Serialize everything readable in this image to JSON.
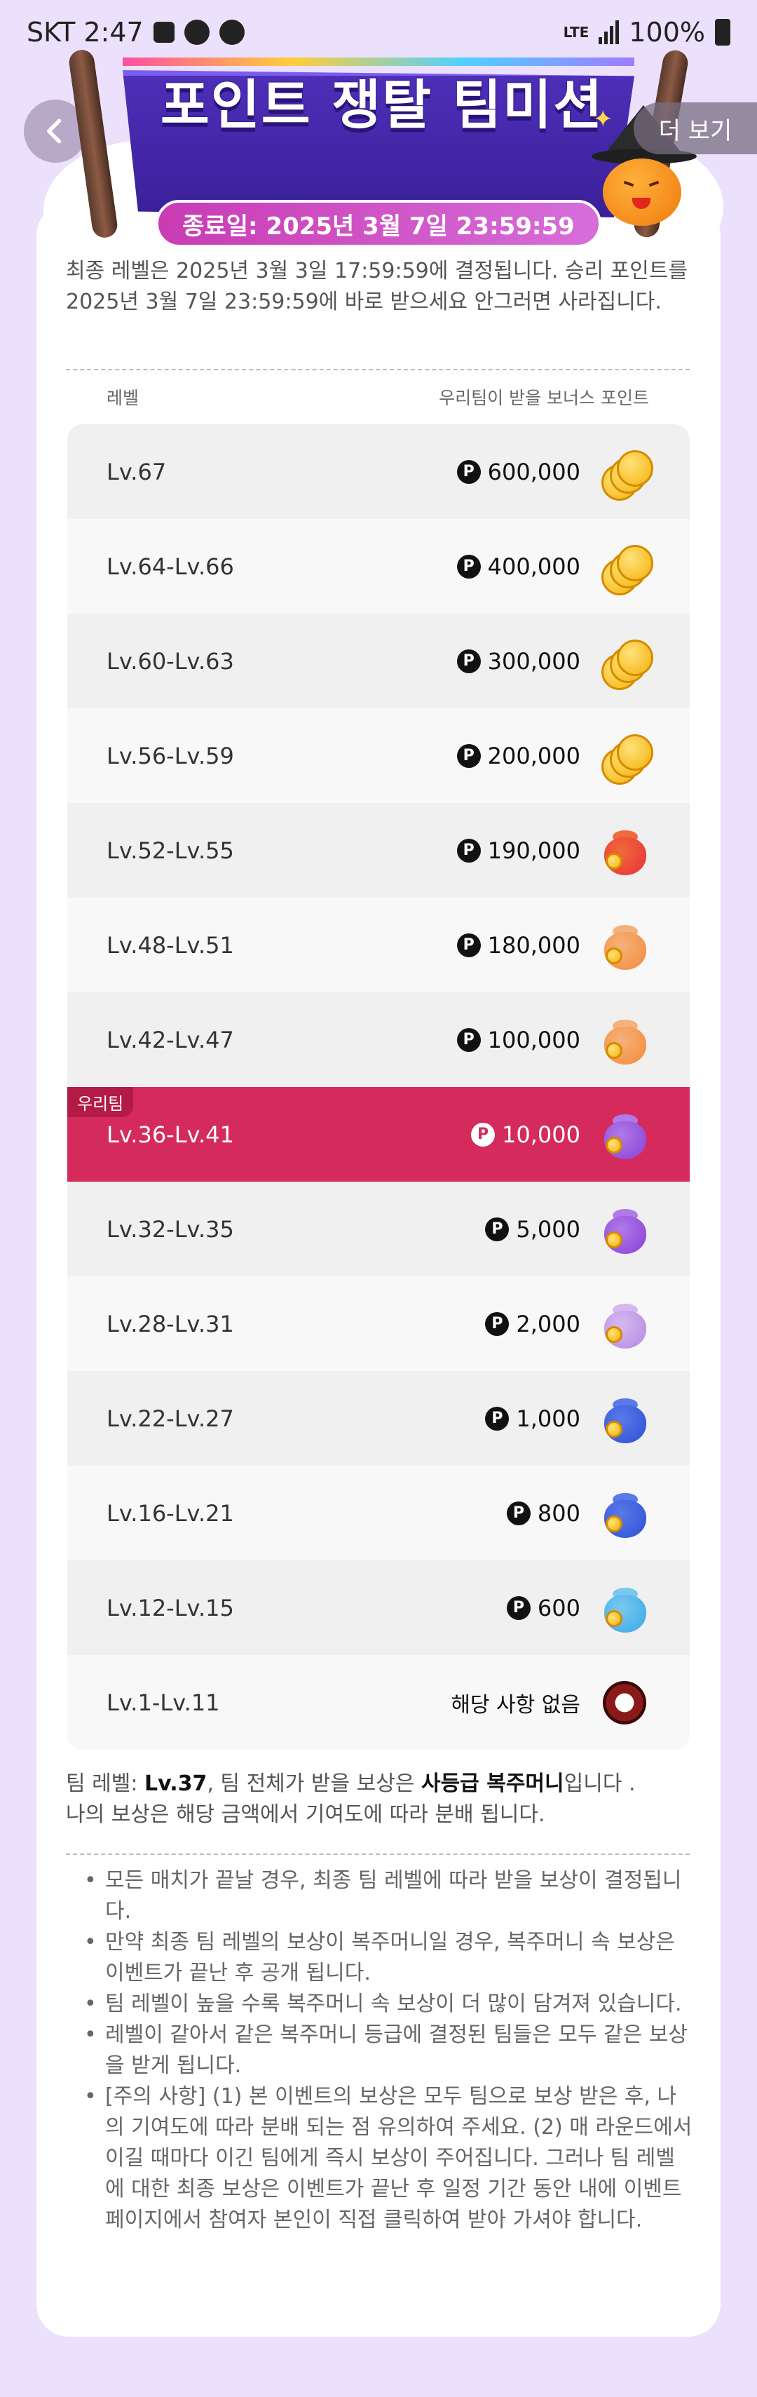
{
  "status_bar": {
    "carrier_time": "SKT 2:47",
    "battery": "100%",
    "network": "LTE"
  },
  "header": {
    "back_icon": "chevron-left-icon",
    "more_label": "더 보기"
  },
  "banner": {
    "title": "포인트 쟁탈 팀미션",
    "end_date": "종료일: 2025년 3월 7일 23:59:59"
  },
  "intro": "최종 레벨은 2025년 3월 3일 17:59:59에 결정됩니다. 승리 포인트를 2025년 3월 7일 23:59:59에 바로 받으세요 안그러면 사라집니다.",
  "table": {
    "col_level": "레벨",
    "col_bonus": "우리팀이 받을 보너스 포인트",
    "my_team_tag": "우리팀",
    "rows": [
      {
        "level": "Lv.67",
        "points": "600,000",
        "icon": "coin-stack-icon"
      },
      {
        "level": "Lv.64-Lv.66",
        "points": "400,000",
        "icon": "coin-stack-icon"
      },
      {
        "level": "Lv.60-Lv.63",
        "points": "300,000",
        "icon": "coin-stack-icon"
      },
      {
        "level": "Lv.56-Lv.59",
        "points": "200,000",
        "icon": "coin-stack-icon"
      },
      {
        "level": "Lv.52-Lv.55",
        "points": "190,000",
        "icon": "red-pouch-icon"
      },
      {
        "level": "Lv.48-Lv.51",
        "points": "180,000",
        "icon": "orange-pouch-icon"
      },
      {
        "level": "Lv.42-Lv.47",
        "points": "100,000",
        "icon": "orange-pouch-icon"
      },
      {
        "level": "Lv.36-Lv.41",
        "points": "10,000",
        "icon": "purple-pouch-icon",
        "mine": true
      },
      {
        "level": "Lv.32-Lv.35",
        "points": "5,000",
        "icon": "purple-pouch-icon"
      },
      {
        "level": "Lv.28-Lv.31",
        "points": "2,000",
        "icon": "lavender-pouch-icon"
      },
      {
        "level": "Lv.22-Lv.27",
        "points": "1,000",
        "icon": "blue-pouch-icon"
      },
      {
        "level": "Lv.16-Lv.21",
        "points": "800",
        "icon": "blue-pouch-icon"
      },
      {
        "level": "Lv.12-Lv.15",
        "points": "600",
        "icon": "lightblue-pouch-icon"
      },
      {
        "level": "Lv.1-Lv.11",
        "points": "해당 사항 없음",
        "icon": "drum-icon",
        "none": true
      }
    ]
  },
  "summary": {
    "prefix": "팀 레벨: ",
    "team_level": "Lv.37",
    "mid": ", 팀 전체가 받을 보상은 ",
    "reward_grade": "사등급 복주머니",
    "suffix": "입니다 .",
    "line2": "나의 보상은 해당 금액에서 기여도에 따라 분배 됩니다."
  },
  "notes": [
    "모든 매치가 끝날 경우, 최종 팀 레벨에 따라 받을 보상이 결정됩니다.",
    "만약 최종 팀 레벨의 보상이 복주머니일 경우, 복주머니 속 보상은 이벤트가 끝난 후 공개 됩니다.",
    "팀 레벨이 높을 수록 복주머니 속 보상이 더 많이 담겨져 있습니다.",
    "레벨이 같아서 같은 복주머니 등급에 결정된 팀들은 모두 같은 보상을 받게 됩니다.",
    "[주의 사항] (1) 본 이벤트의 보상은 모두 팀으로 보상 받은 후, 나의 기여도에 따라 분배 되는 점 유의하여 주세요. (2) 매 라운드에서 이길 때마다 이긴 팀에게 즉시 보상이 주어집니다. 그러나 팀 레벨에 대한 최종 보상은 이벤트가 끝난 후 일정 기간 동안 내에 이벤트 페이지에서 참여자 본인이 직접 클릭하여 받아 가셔야 합니다."
  ]
}
